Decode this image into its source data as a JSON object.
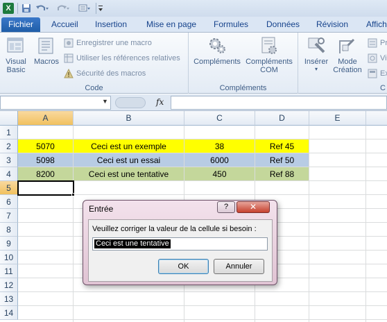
{
  "quick_access": {
    "app_icon": "excel-icon",
    "buttons": [
      "save-icon",
      "undo-icon",
      "redo-icon",
      "customize-icon"
    ]
  },
  "tabs": {
    "file": "Fichier",
    "items": [
      "Accueil",
      "Insertion",
      "Mise en page",
      "Formules",
      "Données",
      "Révision",
      "Affich"
    ]
  },
  "ribbon": {
    "code": {
      "label": "Code",
      "visual_basic": "Visual\nBasic",
      "macros": "Macros",
      "record_macro": "Enregistrer une macro",
      "relative_refs": "Utiliser les références relatives",
      "macro_security": "Sécurité des macros"
    },
    "addins": {
      "label": "Compléments",
      "complements": "Compléments",
      "complements_com": "Compléments\nCOM"
    },
    "controls": {
      "insert": "Insérer",
      "design_mode": "Mode\nCréation",
      "partial": [
        "Pr",
        "Vi",
        "Ex"
      ],
      "label_partial": "C"
    }
  },
  "formula_bar": {
    "name_box": "",
    "fx_label": "fx",
    "formula": ""
  },
  "sheet": {
    "columns": [
      "A",
      "B",
      "C",
      "D",
      "E"
    ],
    "rows": [
      "1",
      "2",
      "3",
      "4",
      "5",
      "6",
      "7",
      "8",
      "9",
      "10",
      "11",
      "12",
      "13",
      "14"
    ],
    "selected_cell": "A5",
    "data": [
      {
        "a": "5070",
        "b": "Ceci est un exemple",
        "c": "38",
        "d": "Ref 45",
        "fill": "#ffff00"
      },
      {
        "a": "5098",
        "b": "Ceci est un essai",
        "c": "6000",
        "d": "Ref 50",
        "fill": "#b8cce4"
      },
      {
        "a": "8200",
        "b": "Ceci est une tentative",
        "c": "450",
        "d": "Ref 88",
        "fill": "#c4d79b"
      }
    ]
  },
  "dialog": {
    "title": "Entrée",
    "help_label": "?",
    "close_label": "✕",
    "prompt": "Veuillez corriger la valeur de la cellule si besoin :",
    "input_value": "Ceci est une tentative",
    "ok_label": "OK",
    "cancel_label": "Annuler"
  }
}
